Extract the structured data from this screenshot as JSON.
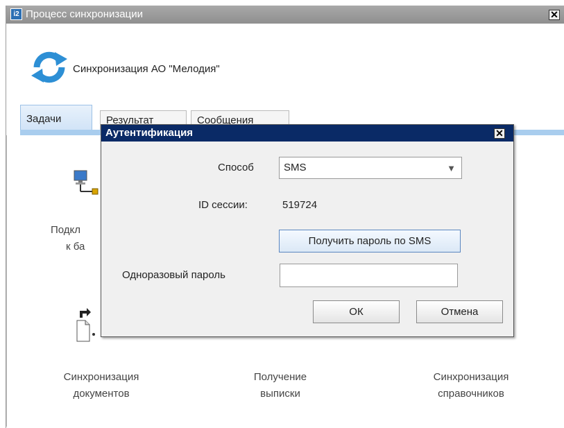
{
  "window": {
    "title": "Процесс синхронизации",
    "close_glyph": "✕"
  },
  "header": {
    "text": "Синхронизация АО \"Мелодия\"",
    "icon": "sync-icon"
  },
  "tabs": [
    {
      "label": "Задачи",
      "active": true
    },
    {
      "label": "Результат",
      "active": false
    },
    {
      "label": "Сообщения",
      "active": false
    }
  ],
  "tiles": {
    "connect": {
      "line1": "Подкл",
      "line2": "к ба",
      "icon": "computer-connect-icon"
    },
    "docs": {
      "line1": "Синхронизация",
      "line2": "документов",
      "icon": "document-arrow-icon"
    },
    "statement": {
      "line1": "Получение",
      "line2": "выписки"
    },
    "refs": {
      "line1": "Синхронизация",
      "line2": "справочников"
    }
  },
  "dialog": {
    "title": "Аутентификация",
    "close_glyph": "✕",
    "method_label": "Способ",
    "method_value": "SMS",
    "session_label": "ID сессии:",
    "session_value": "519724",
    "get_password_button": "Получить пароль по SMS",
    "otp_label": "Одноразовый пароль",
    "otp_value": "",
    "ok_button": "ОК",
    "cancel_button": "Отмена"
  },
  "colors": {
    "titlebar": "#9b9b9b",
    "dialog_titlebar": "#0a2a66",
    "tab_active": "#d0e3f7",
    "sync_icon": "#2d8fd5"
  }
}
